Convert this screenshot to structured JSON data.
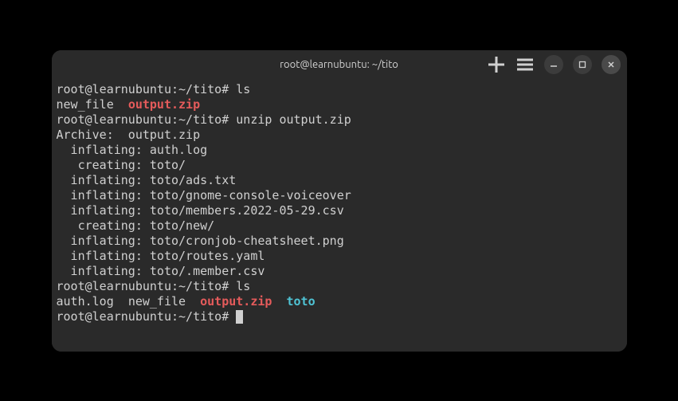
{
  "window": {
    "title": "root@learnubuntu: ~/tito"
  },
  "prompt": "root@learnubuntu:~/tito#",
  "cmd1": "ls",
  "ls1": {
    "f1": "new_file",
    "f2": "output.zip"
  },
  "cmd2": "unzip output.zip",
  "unzip": {
    "archive": "Archive:  output.zip",
    "l1": "  inflating: auth.log            ",
    "l2": "   creating: toto/",
    "l3": "  inflating: toto/ads.txt        ",
    "l4": "  inflating: toto/gnome-console-voiceover  ",
    "l5": "  inflating: toto/members.2022-05-29.csv  ",
    "l6": "   creating: toto/new/",
    "l7": "  inflating: toto/cronjob-cheatsheet.png  ",
    "l8": "  inflating: toto/routes.yaml    ",
    "l9": "  inflating: toto/.member.csv    "
  },
  "cmd3": "ls",
  "ls2": {
    "f1": "auth.log",
    "f2": "new_file",
    "f3": "output.zip",
    "f4": "toto"
  }
}
